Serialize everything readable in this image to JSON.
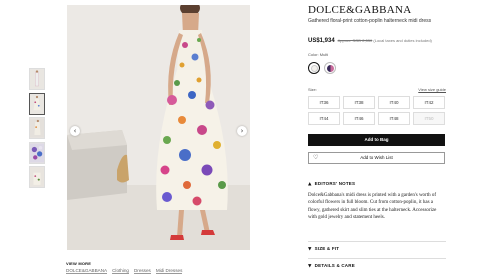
{
  "gallery": {
    "thumbnails": [
      "thumbnail-1",
      "thumbnail-2",
      "thumbnail-3",
      "thumbnail-4",
      "thumbnail-5"
    ],
    "active_index": 1,
    "prev_icon": "‹",
    "next_icon": "›"
  },
  "view_more": {
    "title": "VIEW MORE",
    "links": [
      "DOLCE&GABBANA",
      "Clothing",
      "Dresses",
      "Midi Dresses"
    ]
  },
  "product": {
    "brand": "DOLCE&GABBANA",
    "name": "Gathered floral-print cotton-poplin halterneck midi dress",
    "price": "US$1,934",
    "original_price": "Approx. SGD 2,550",
    "tax_note": "(Local taxes and duties included)",
    "color_label": "Color: Multi",
    "colors": [
      "#f4f2ee",
      "#7b4b8a"
    ],
    "size_label": "Size:",
    "size_guide": "View size guide",
    "sizes": [
      {
        "label": "IT36",
        "available": true
      },
      {
        "label": "IT38",
        "available": true
      },
      {
        "label": "IT40",
        "available": true
      },
      {
        "label": "IT42",
        "available": true
      },
      {
        "label": "IT44",
        "available": true
      },
      {
        "label": "IT46",
        "available": true
      },
      {
        "label": "IT48",
        "available": true
      },
      {
        "label": "IT50",
        "available": false
      }
    ],
    "add_to_bag": "Add to Bag",
    "add_to_wishlist": "Add to Wish List",
    "heart_icon": "♡"
  },
  "sections": {
    "notes_title": "EDITORS' NOTES",
    "notes_body": "Dolce&Gabbana's midi dress is printed with a garden's worth of colorful flowers in full bloom. Cut from cotton-poplin, it has a flowy, gathered skirt and slim ties at the halterneck. Accessorize with gold jewelry and statement heels.",
    "size_fit_title": "SIZE & FIT",
    "details_title": "DETAILS & CARE",
    "chevron_up": "▲",
    "chevron_down": "▼"
  }
}
